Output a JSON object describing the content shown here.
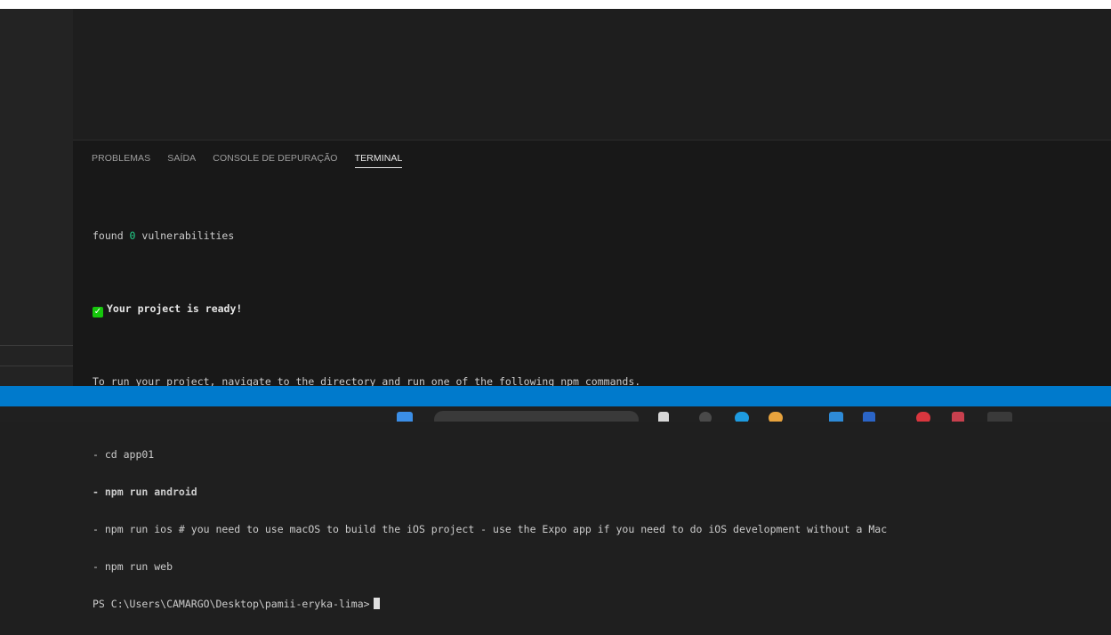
{
  "panel": {
    "tabs": [
      {
        "label": "PROBLEMAS",
        "active": false
      },
      {
        "label": "SAÍDA",
        "active": false
      },
      {
        "label": "CONSOLE DE DEPURAÇÃO",
        "active": false
      },
      {
        "label": "TERMINAL",
        "active": true
      }
    ]
  },
  "terminal": {
    "found_prefix": "found ",
    "found_count": "0",
    "found_suffix": " vulnerabilities",
    "ready_icon": "green-check-icon",
    "ready_text": "Your project is ready!",
    "instructions": "To run your project, navigate to the directory and run one of the following npm commands.",
    "commands": [
      "- cd app01",
      "- npm run android",
      "- npm run ios # you need to use macOS to build the iOS project - use the Expo app if you need to do iOS development without a Mac",
      "- npm run web"
    ],
    "prompt": "PS C:\\Users\\CAMARGO\\Desktop\\pamii-eryka-lima>"
  },
  "colors": {
    "statusbar": "#007acc",
    "panel_bg": "#181818",
    "success": "#16c60c",
    "number": "#23d18b"
  }
}
